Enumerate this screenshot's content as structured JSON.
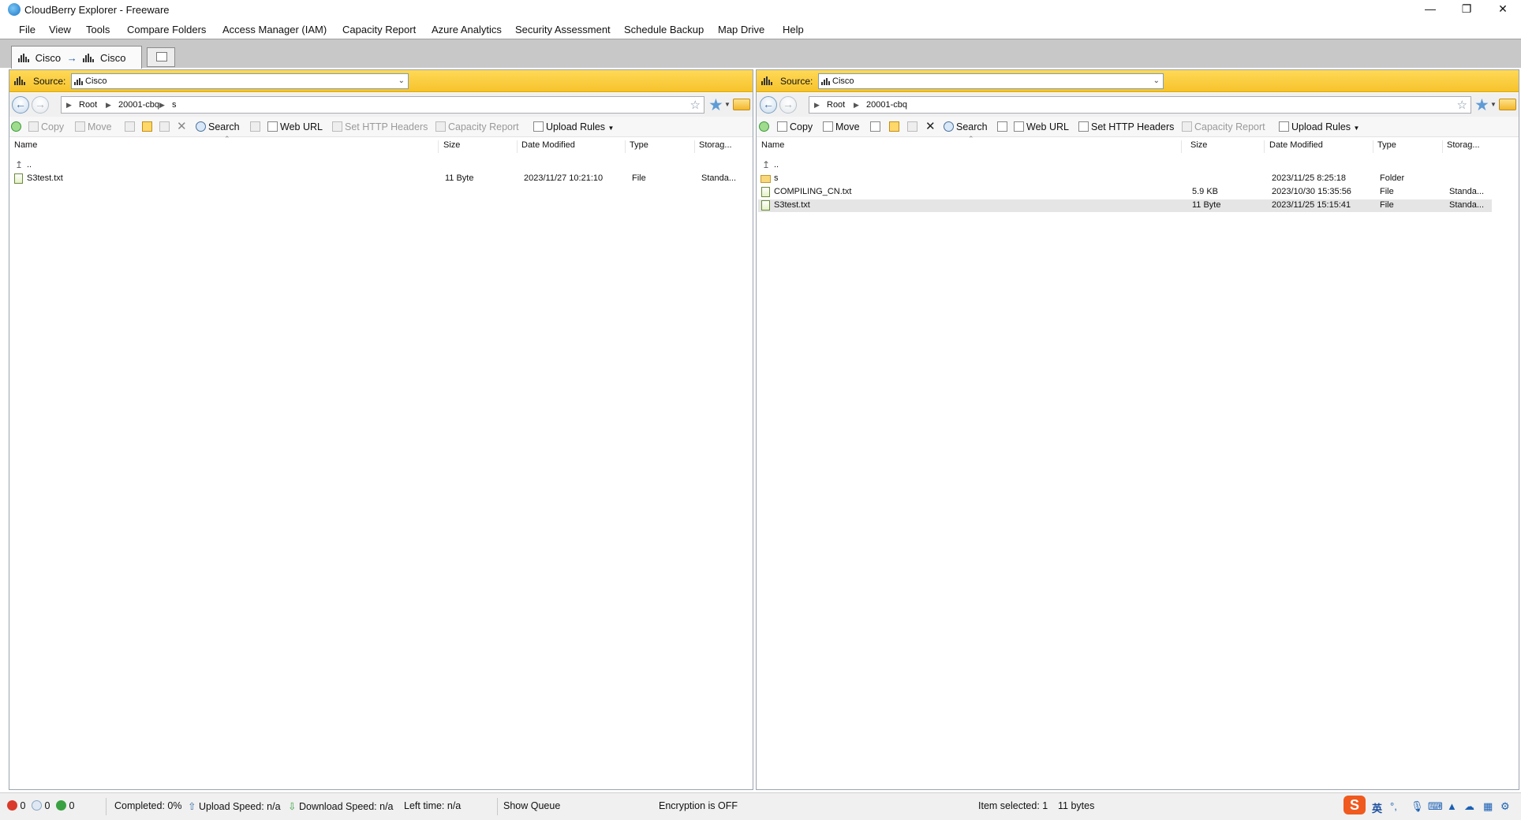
{
  "window": {
    "title": "CloudBerry Explorer - Freeware",
    "controls": [
      "minimize",
      "restore",
      "close"
    ]
  },
  "menu": [
    "File",
    "View",
    "Tools",
    "Compare Folders",
    "Access Manager (IAM)",
    "Capacity Report",
    "Azure Analytics",
    "Security Assessment",
    "Schedule Backup",
    "Map Drive",
    "Help"
  ],
  "tab": {
    "left_name": "Cisco",
    "arrow": "→",
    "right_name": "Cisco"
  },
  "left": {
    "source_label": "Source:",
    "source_value": "Cisco",
    "breadcrumb": [
      "Root",
      "20001-cbq",
      "s"
    ],
    "toolbar": {
      "copy": "Copy",
      "move": "Move",
      "search": "Search",
      "web_url": "Web URL",
      "http_headers": "Set HTTP Headers",
      "capacity": "Capacity Report",
      "upload_rules": "Upload Rules"
    },
    "columns": [
      "Name",
      "Size",
      "Date Modified",
      "Type",
      "Storag..."
    ],
    "parent_row": "..",
    "rows": [
      {
        "name": "S3test.txt",
        "size": "11 Byte",
        "date": "2023/11/27 10:21:10",
        "type": "File",
        "storage": "Standa..."
      }
    ]
  },
  "right": {
    "source_label": "Source:",
    "source_value": "Cisco",
    "breadcrumb": [
      "Root",
      "20001-cbq"
    ],
    "toolbar": {
      "copy": "Copy",
      "move": "Move",
      "search": "Search",
      "web_url": "Web URL",
      "http_headers": "Set HTTP Headers",
      "capacity": "Capacity Report",
      "upload_rules": "Upload Rules"
    },
    "columns": [
      "Name",
      "Size",
      "Date Modified",
      "Type",
      "Storag..."
    ],
    "parent_row": "..",
    "rows": [
      {
        "name": "s",
        "size": "",
        "date": "2023/11/25 8:25:18",
        "type": "Folder",
        "storage": "",
        "icon": "folder"
      },
      {
        "name": "COMPILING_CN.txt",
        "size": "5.9 KB",
        "date": "2023/10/30 15:35:56",
        "type": "File",
        "storage": "Standa...",
        "icon": "file"
      },
      {
        "name": "S3test.txt",
        "size": "11 Byte",
        "date": "2023/11/25 15:15:41",
        "type": "File",
        "storage": "Standa...",
        "icon": "file",
        "selected": true
      }
    ]
  },
  "status": {
    "errors": "0",
    "pending": "0",
    "running": "0",
    "completed": "Completed: 0%",
    "upload_speed": "Upload Speed: n/a",
    "download_speed": "Download Speed: n/a",
    "left_time": "Left time: n/a",
    "show_queue": "Show Queue",
    "encryption": "Encryption is OFF",
    "item_selected": "Item selected: 1",
    "bytes": "11 bytes"
  },
  "tray": {
    "ime_lang": "英",
    "ime_logo": "S"
  },
  "colors": {
    "source_bar": "#f6c32c",
    "selected_row": "#e5e5e5",
    "error_icon": "#d93a2b",
    "play_icon": "#3aa142"
  }
}
